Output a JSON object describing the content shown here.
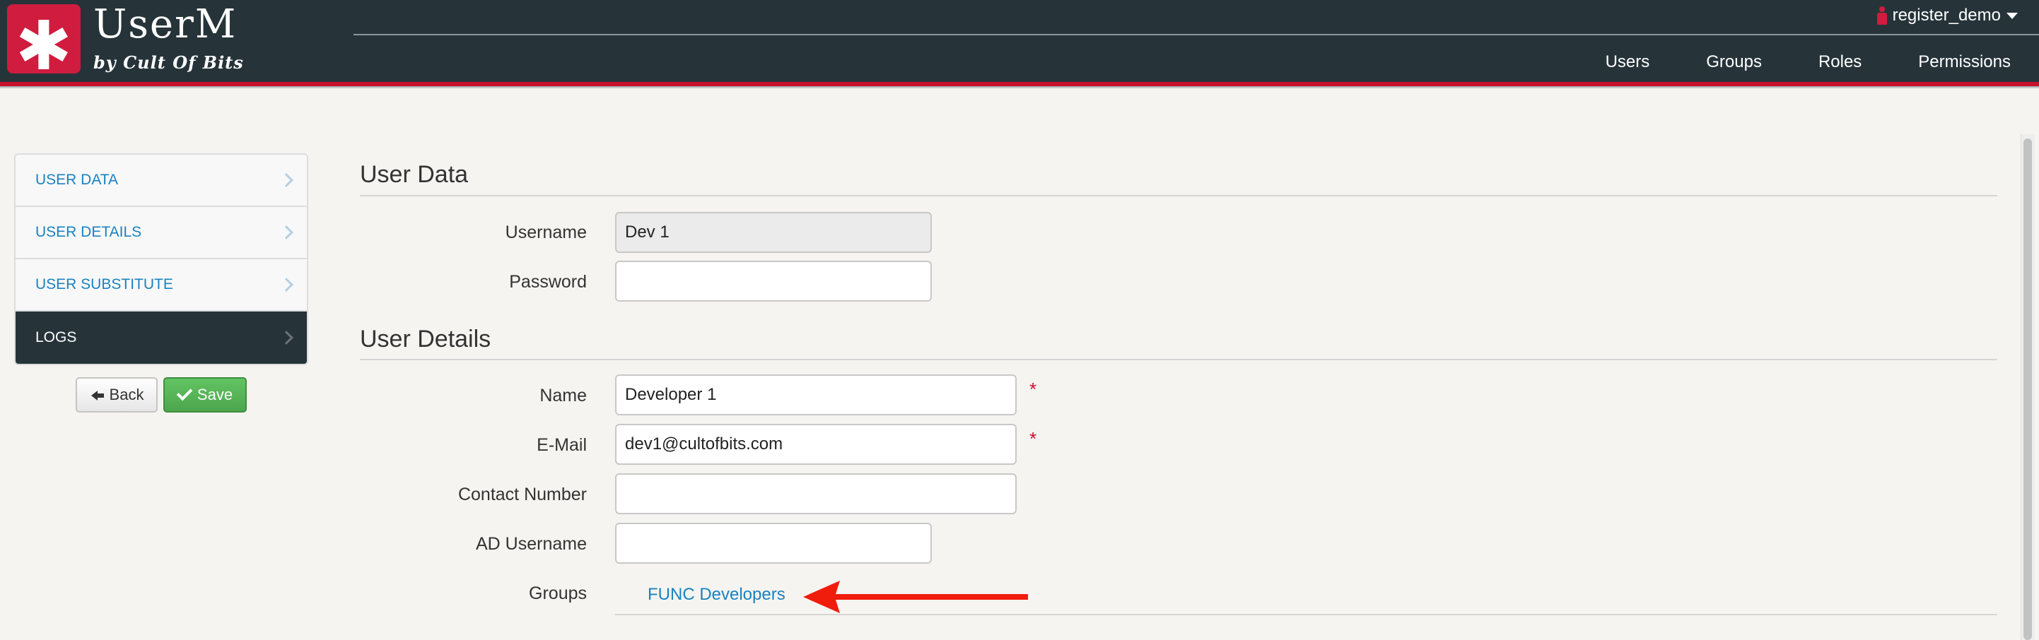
{
  "app": {
    "brand_name": "UserM",
    "brand_tagline": "by Cult Of Bits",
    "current_user": "register_demo"
  },
  "topnav": {
    "items": [
      "Users",
      "Groups",
      "Roles",
      "Permissions"
    ]
  },
  "sidebar": {
    "items": [
      {
        "label": "USER DATA",
        "active": false
      },
      {
        "label": "USER DETAILS",
        "active": false
      },
      {
        "label": "USER SUBSTITUTE",
        "active": false
      },
      {
        "label": "LOGS",
        "active": true
      }
    ]
  },
  "buttons": {
    "back_label": "Back",
    "save_label": "Save"
  },
  "sections": {
    "user_data_title": "User Data",
    "user_details_title": "User Details"
  },
  "form": {
    "username": {
      "label": "Username",
      "value": "Dev 1",
      "readonly": true
    },
    "password": {
      "label": "Password",
      "value": ""
    },
    "name": {
      "label": "Name",
      "value": "Developer 1",
      "required_mark": "*"
    },
    "email": {
      "label": "E-Mail",
      "value": "dev1@cultofbits.com",
      "required_mark": "*"
    },
    "contact_number": {
      "label": "Contact Number",
      "value": ""
    },
    "ad_username": {
      "label": "AD Username",
      "value": ""
    },
    "groups": {
      "label": "Groups",
      "items": [
        "FUNC Developers"
      ]
    }
  },
  "colors": {
    "header_bg": "#26343a",
    "accent_red": "#c8102e",
    "link_blue": "#1a82c0",
    "save_green": "#5cb85c"
  }
}
